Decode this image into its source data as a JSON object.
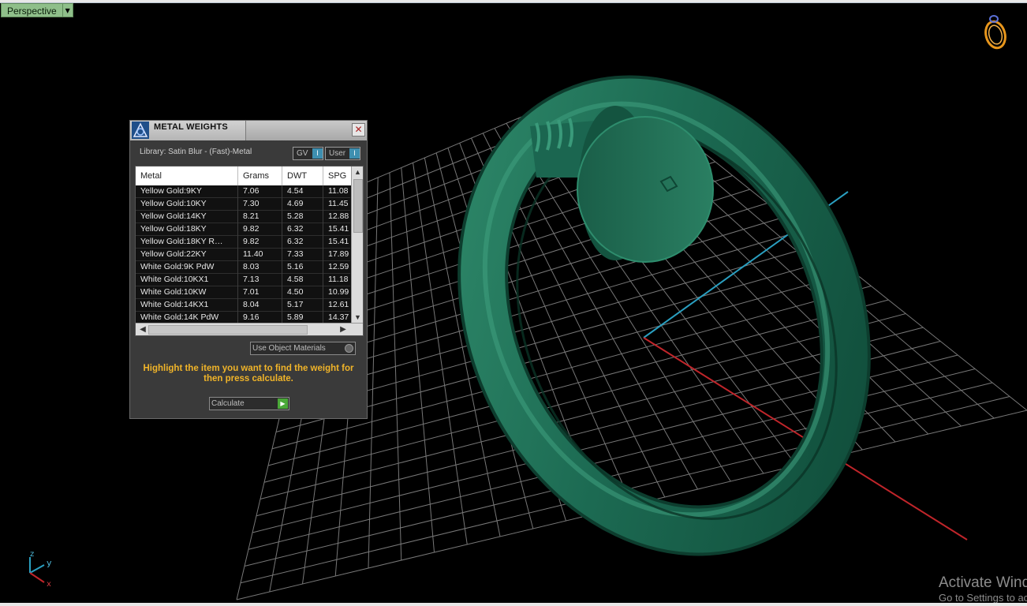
{
  "viewport": {
    "name": "Perspective",
    "menu_icon": "triangle-down"
  },
  "watermark": {
    "line1": "Activate Windows",
    "line2": "Go to Settings to activate Windows."
  },
  "axis": {
    "x": "x",
    "y": "y",
    "z": "z"
  },
  "dialog": {
    "title": "METAL WEIGHTS",
    "close_icon": "close-x",
    "library_label": "Library: Satin Blur - (Fast)-Metal",
    "toggle_gv": "GV",
    "toggle_user": "User",
    "toggle_state": "I",
    "columns": [
      "Metal",
      "Grams",
      "DWT",
      "SPG"
    ],
    "rows": [
      [
        "Yellow Gold:9KY",
        "7.06",
        "4.54",
        "11.08"
      ],
      [
        "Yellow Gold:10KY",
        "7.30",
        "4.69",
        "11.45"
      ],
      [
        "Yellow Gold:14KY",
        "8.21",
        "5.28",
        "12.88"
      ],
      [
        "Yellow Gold:18KY",
        "9.82",
        "6.32",
        "15.41"
      ],
      [
        "Yellow Gold:18KY R…",
        "9.82",
        "6.32",
        "15.41"
      ],
      [
        "Yellow Gold:22KY",
        "11.40",
        "7.33",
        "17.89"
      ],
      [
        "White Gold:9K PdW",
        "8.03",
        "5.16",
        "12.59"
      ],
      [
        "White Gold:10KX1",
        "7.13",
        "4.58",
        "11.18"
      ],
      [
        "White Gold:10KW",
        "7.01",
        "4.50",
        "10.99"
      ],
      [
        "White Gold:14KX1",
        "8.04",
        "5.17",
        "12.61"
      ],
      [
        "White Gold:14K PdW",
        "9.16",
        "5.89",
        "14.37"
      ]
    ],
    "use_object_materials": "Use Object Materials",
    "hint": "Highlight the item you want to find the weight for then press calculate.",
    "calculate": "Calculate"
  },
  "colors": {
    "ring": "#1f6e55",
    "grid": "#9a9a9a",
    "axis_x": "#c0252a",
    "axis_y": "#2a9fc0",
    "hint": "#f0b429",
    "viewport_tab": "#8fbf8a"
  }
}
